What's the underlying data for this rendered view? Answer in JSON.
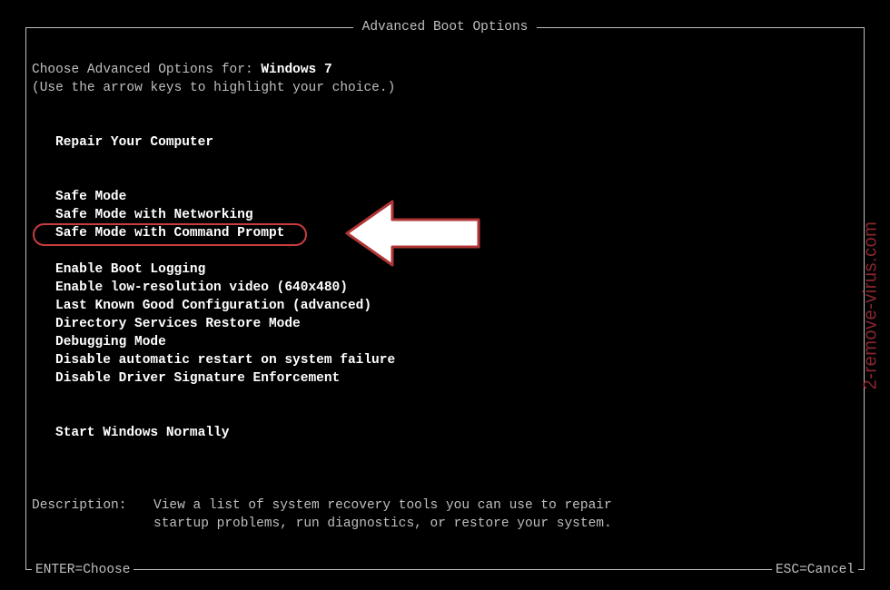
{
  "title": "Advanced Boot Options",
  "header": {
    "line1_prefix": "Choose Advanced Options for: ",
    "os_name": "Windows 7",
    "line2": "(Use the arrow keys to highlight your choice.)"
  },
  "groups": {
    "repair": {
      "item": "Repair Your Computer"
    },
    "safe": [
      "Safe Mode",
      "Safe Mode with Networking",
      "Safe Mode with Command Prompt"
    ],
    "advanced": [
      "Enable Boot Logging",
      "Enable low-resolution video (640x480)",
      "Last Known Good Configuration (advanced)",
      "Directory Services Restore Mode",
      "Debugging Mode",
      "Disable automatic restart on system failure",
      "Disable Driver Signature Enforcement"
    ],
    "normal": {
      "item": "Start Windows Normally"
    }
  },
  "description": {
    "label": "Description:",
    "text_line1": "View a list of system recovery tools you can use to repair",
    "text_line2": "startup problems, run diagnostics, or restore your system."
  },
  "footer": {
    "enter": "ENTER=Choose",
    "esc": "ESC=Cancel"
  },
  "watermark": "2-remove-virus.com",
  "annotation": {
    "highlighted_option": "Safe Mode with Command Prompt"
  }
}
